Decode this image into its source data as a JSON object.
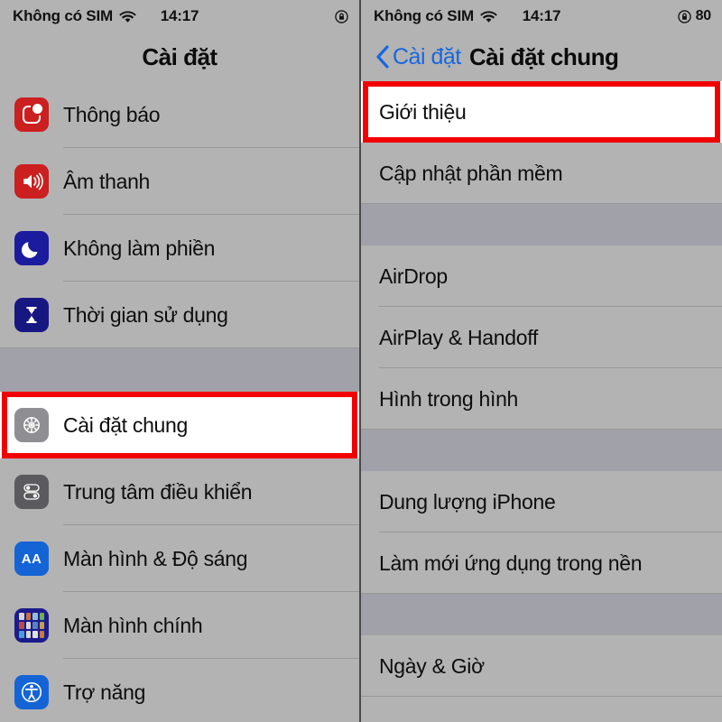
{
  "status_bar": {
    "carrier": "Không có SIM",
    "wifi_icon": "wifi-icon",
    "time": "14:17",
    "rotation_lock_icon": "rotation-lock-icon",
    "battery_percent": "80"
  },
  "left_screen": {
    "nav": {
      "title": "Cài đặt"
    },
    "groups": [
      {
        "items": [
          {
            "label": "Thông báo",
            "icon": "notifications-icon",
            "icon_color": "#cc1f1f",
            "highlighted": false
          },
          {
            "label": "Âm thanh",
            "icon": "sounds-icon",
            "icon_color": "#cc1f1f",
            "highlighted": false
          },
          {
            "label": "Không làm phiền",
            "icon": "do-not-disturb-icon",
            "icon_color": "#1b1b9e",
            "highlighted": false
          },
          {
            "label": "Thời gian sử dụng",
            "icon": "screen-time-icon",
            "icon_color": "#171782",
            "highlighted": false
          }
        ]
      },
      {
        "items": [
          {
            "label": "Cài đặt chung",
            "icon": "general-gear-icon",
            "icon_color": "#8e8e93",
            "highlighted": true
          },
          {
            "label": "Trung tâm điều khiển",
            "icon": "control-center-icon",
            "icon_color": "#5a5a5f",
            "highlighted": false
          },
          {
            "label": "Màn hình & Độ sáng",
            "icon": "display-brightness-icon",
            "icon_color": "#1464d6",
            "highlighted": false
          },
          {
            "label": "Màn hình chính",
            "icon": "home-screen-icon",
            "icon_color": "#1b1b8c",
            "highlighted": false
          },
          {
            "label": "Trợ năng",
            "icon": "accessibility-icon",
            "icon_color": "#1464d6",
            "highlighted": false
          }
        ]
      }
    ]
  },
  "right_screen": {
    "nav": {
      "back_label": "Cài đặt",
      "back_icon": "chevron-left-icon",
      "title": "Cài đặt chung"
    },
    "groups": [
      {
        "items": [
          {
            "label": "Giới thiệu",
            "highlighted": true
          },
          {
            "label": "Cập nhật phần mềm",
            "highlighted": false
          }
        ]
      },
      {
        "items": [
          {
            "label": "AirDrop",
            "highlighted": false
          },
          {
            "label": "AirPlay & Handoff",
            "highlighted": false
          },
          {
            "label": "Hình trong hình",
            "highlighted": false
          }
        ]
      },
      {
        "items": [
          {
            "label": "Dung lượng iPhone",
            "highlighted": false
          },
          {
            "label": "Làm mới ứng dụng trong nền",
            "highlighted": false
          }
        ]
      },
      {
        "items": [
          {
            "label": "Ngày & Giờ",
            "highlighted": false
          }
        ]
      }
    ]
  },
  "colors": {
    "highlight_red": "#f20000",
    "accent_blue": "#1667e0",
    "list_background": "#b3b3b3",
    "group_gap": "#a1a1a9",
    "separator": "#989898"
  }
}
